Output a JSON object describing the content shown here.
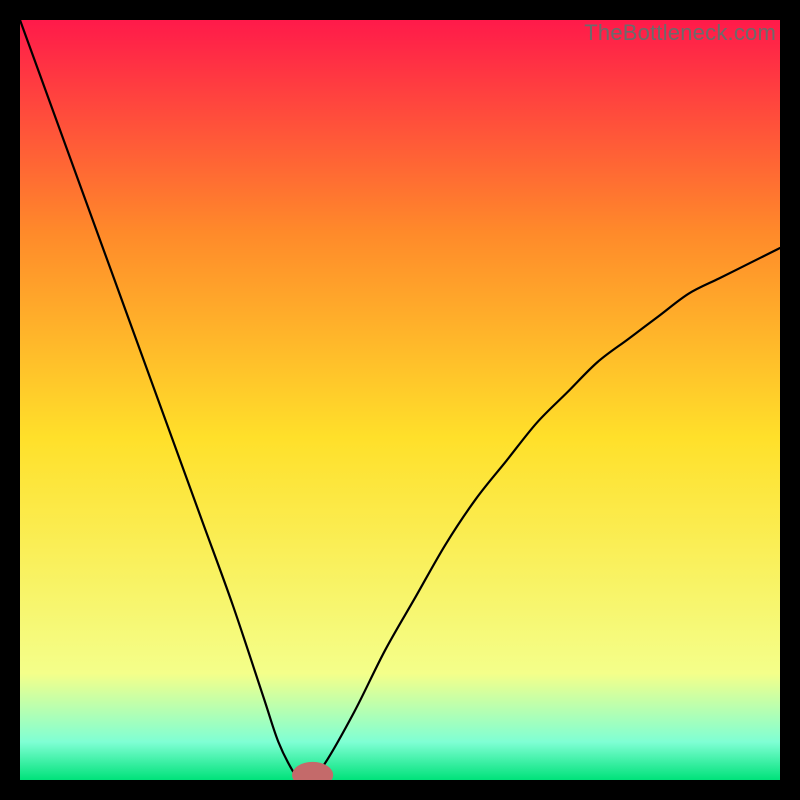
{
  "watermark": "TheBottleneck.com",
  "colors": {
    "frame": "#000000",
    "curve": "#000000",
    "marker": "#c46a6a",
    "gradient_top": "#ff1a4a",
    "gradient_mid_upper": "#ff8a2a",
    "gradient_mid": "#ffe02a",
    "gradient_lower": "#f4ff8a",
    "gradient_green_light": "#7fffd4",
    "gradient_green": "#00e27a"
  },
  "chart_data": {
    "type": "line",
    "title": "",
    "xlabel": "",
    "ylabel": "",
    "xlim": [
      0,
      100
    ],
    "ylim": [
      0,
      100
    ],
    "grid": false,
    "legend": false,
    "description": "Absolute-bottleneck-style V curve. Left branch descends steeply from top-left; curve reaches a flat minimum near x≈37 at y≈0; right branch rises with decreasing slope toward upper-right, ending near y≈70 at x=100.",
    "series": [
      {
        "name": "bottleneck-curve",
        "x": [
          0,
          4,
          8,
          12,
          16,
          20,
          24,
          28,
          32,
          34,
          36,
          37,
          38,
          40,
          44,
          48,
          52,
          56,
          60,
          64,
          68,
          72,
          76,
          80,
          84,
          88,
          92,
          96,
          100
        ],
        "values": [
          100,
          89,
          78,
          67,
          56,
          45,
          34,
          23,
          11,
          5,
          1,
          0,
          0,
          2,
          9,
          17,
          24,
          31,
          37,
          42,
          47,
          51,
          55,
          58,
          61,
          64,
          66,
          68,
          70
        ]
      }
    ],
    "marker": {
      "x": 38.5,
      "y": 0,
      "rx": 1.6,
      "ry": 1.0
    },
    "background_gradient_stops": [
      {
        "offset": 0.0,
        "key": "gradient_top"
      },
      {
        "offset": 0.28,
        "key": "gradient_mid_upper"
      },
      {
        "offset": 0.55,
        "key": "gradient_mid"
      },
      {
        "offset": 0.86,
        "key": "gradient_lower"
      },
      {
        "offset": 0.95,
        "key": "gradient_green_light"
      },
      {
        "offset": 1.0,
        "key": "gradient_green"
      }
    ]
  }
}
